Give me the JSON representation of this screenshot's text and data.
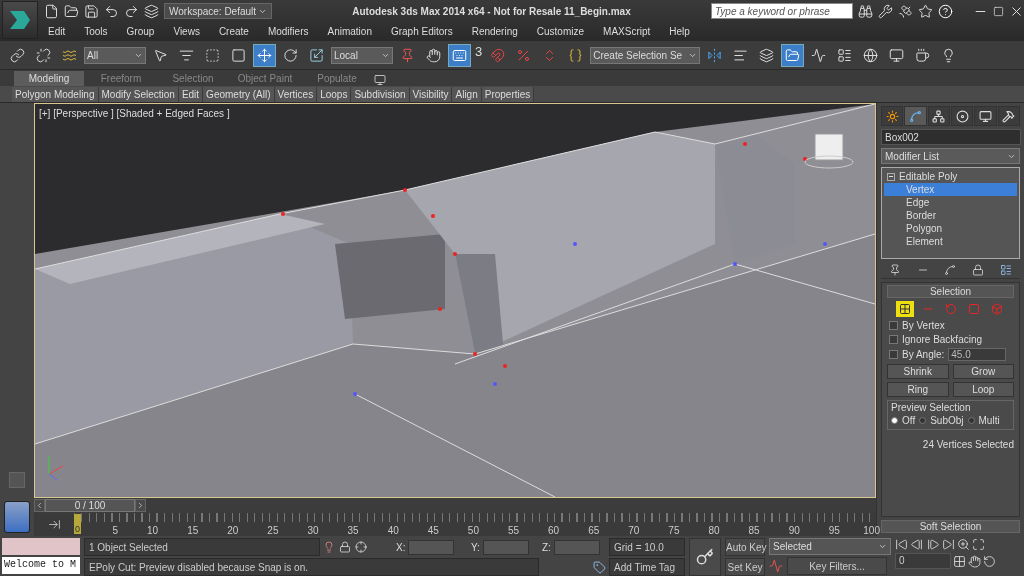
{
  "title_bar": {
    "workspace": "Workspace: Default",
    "title": "Autodesk 3ds Max  2014 x64  - Not for Resale   11_Begin.max",
    "search": {
      "placeholder": "Type a keyword or phrase"
    }
  },
  "menu": [
    "Edit",
    "Tools",
    "Group",
    "Views",
    "Create",
    "Modifiers",
    "Animation",
    "Graph Editors",
    "Rendering",
    "Customize",
    "MAXScript",
    "Help"
  ],
  "toolbar": [
    {
      "kind": "button",
      "selected": false
    },
    {
      "kind": "button",
      "selected": false
    },
    {
      "kind": "button",
      "selected": false
    },
    {
      "kind": "dropdown",
      "value": "All"
    },
    {
      "kind": "button",
      "selected": false
    },
    {
      "kind": "button",
      "selected": false
    },
    {
      "kind": "button",
      "selected": false
    },
    {
      "kind": "button",
      "selected": false
    },
    {
      "kind": "button",
      "selected": true
    },
    {
      "kind": "button",
      "selected": false
    },
    {
      "kind": "button",
      "selected": false
    },
    {
      "kind": "dropdown",
      "value": "Local"
    },
    {
      "kind": "button",
      "selected": false
    },
    {
      "kind": "button",
      "selected": false
    },
    {
      "kind": "button",
      "selected": true
    },
    {
      "kind": "snap",
      "label": "3"
    },
    {
      "kind": "button",
      "selected": false
    },
    {
      "kind": "button",
      "selected": false
    },
    {
      "kind": "button",
      "selected": false
    },
    {
      "kind": "button",
      "selected": false
    },
    {
      "kind": "dropdown",
      "value": "Create Selection Se"
    },
    {
      "kind": "button",
      "selected": false
    },
    {
      "kind": "button",
      "selected": false
    },
    {
      "kind": "button",
      "selected": false
    },
    {
      "kind": "button",
      "selected": true
    },
    {
      "kind": "button",
      "selected": false
    },
    {
      "kind": "button",
      "selected": false
    },
    {
      "kind": "button",
      "selected": false
    },
    {
      "kind": "button",
      "selected": false
    },
    {
      "kind": "button",
      "selected": false
    },
    {
      "kind": "button",
      "selected": false
    }
  ],
  "ribbon": {
    "tabs": [
      {
        "label": "Modeling",
        "selected": true
      },
      {
        "label": "Freeform",
        "selected": false
      },
      {
        "label": "Selection",
        "selected": false
      },
      {
        "label": "Object Paint",
        "selected": false
      },
      {
        "label": "Populate",
        "selected": false
      }
    ],
    "panels": [
      "Polygon Modeling",
      "Modify Selection",
      "Edit",
      "Geometry (All)",
      "Vertices",
      "Loops",
      "Subdivision",
      "Visibility",
      "Align",
      "Properties"
    ]
  },
  "viewport": {
    "label": "[+] [Perspective ] [Shaded + Edged Faces ]"
  },
  "command_panel": {
    "tabs": [
      {
        "selected": false
      },
      {
        "selected": true
      },
      {
        "selected": false
      },
      {
        "selected": false
      },
      {
        "selected": false
      },
      {
        "selected": false
      }
    ],
    "object_name": "Box002",
    "modifier_list": "Modifier List",
    "stack": [
      {
        "label": "Editable Poly",
        "selected": false,
        "expanded": true,
        "children": [
          {
            "label": "Vertex",
            "selected": true
          },
          {
            "label": "Edge",
            "selected": false
          },
          {
            "label": "Border",
            "selected": false
          },
          {
            "label": "Polygon",
            "selected": false
          },
          {
            "label": "Element",
            "selected": false
          }
        ]
      }
    ],
    "selection": {
      "title": "Selection",
      "levels": [
        {
          "selected": true
        },
        {
          "selected": false
        },
        {
          "selected": false
        },
        {
          "selected": false
        },
        {
          "selected": false
        }
      ],
      "checkboxes": [
        {
          "label": "By Vertex",
          "checked": false
        },
        {
          "label": "Ignore Backfacing",
          "checked": false
        }
      ],
      "by_angle": {
        "label": "By Angle:",
        "checked": false,
        "value": "45.0"
      },
      "buttons": [
        "Shrink",
        "Grow"
      ],
      "spinner_buttons": [
        "Ring",
        "Loop"
      ],
      "preview": {
        "title": "Preview Selection",
        "options": [
          {
            "label": "Off",
            "selected": true
          },
          {
            "label": "SubObj",
            "selected": false
          },
          {
            "label": "Multi",
            "selected": false
          }
        ]
      },
      "status": "24 Vertices Selected"
    },
    "soft_selection": "Soft Selection"
  },
  "timeline": {
    "frame": "0 / 100",
    "current": "0",
    "ticks": [
      "5",
      "10",
      "15",
      "20",
      "25",
      "30",
      "35",
      "40",
      "45",
      "50",
      "55",
      "60",
      "65",
      "70",
      "75",
      "80",
      "85",
      "90",
      "95",
      "100"
    ]
  },
  "status": {
    "listener": "Welcome to M",
    "selection": "1 Object Selected",
    "prompt": "EPoly Cut: Preview disabled because Snap is on.",
    "x_label": "X:",
    "y_label": "Y:",
    "z_label": "Z:",
    "grid": "Grid = 10.0",
    "time_tag": "Add Time Tag",
    "auto_key": "Auto Key",
    "set_key": "Set Key",
    "key_mode": "Selected",
    "key_filters": "Key Filters...",
    "frame": "0"
  }
}
